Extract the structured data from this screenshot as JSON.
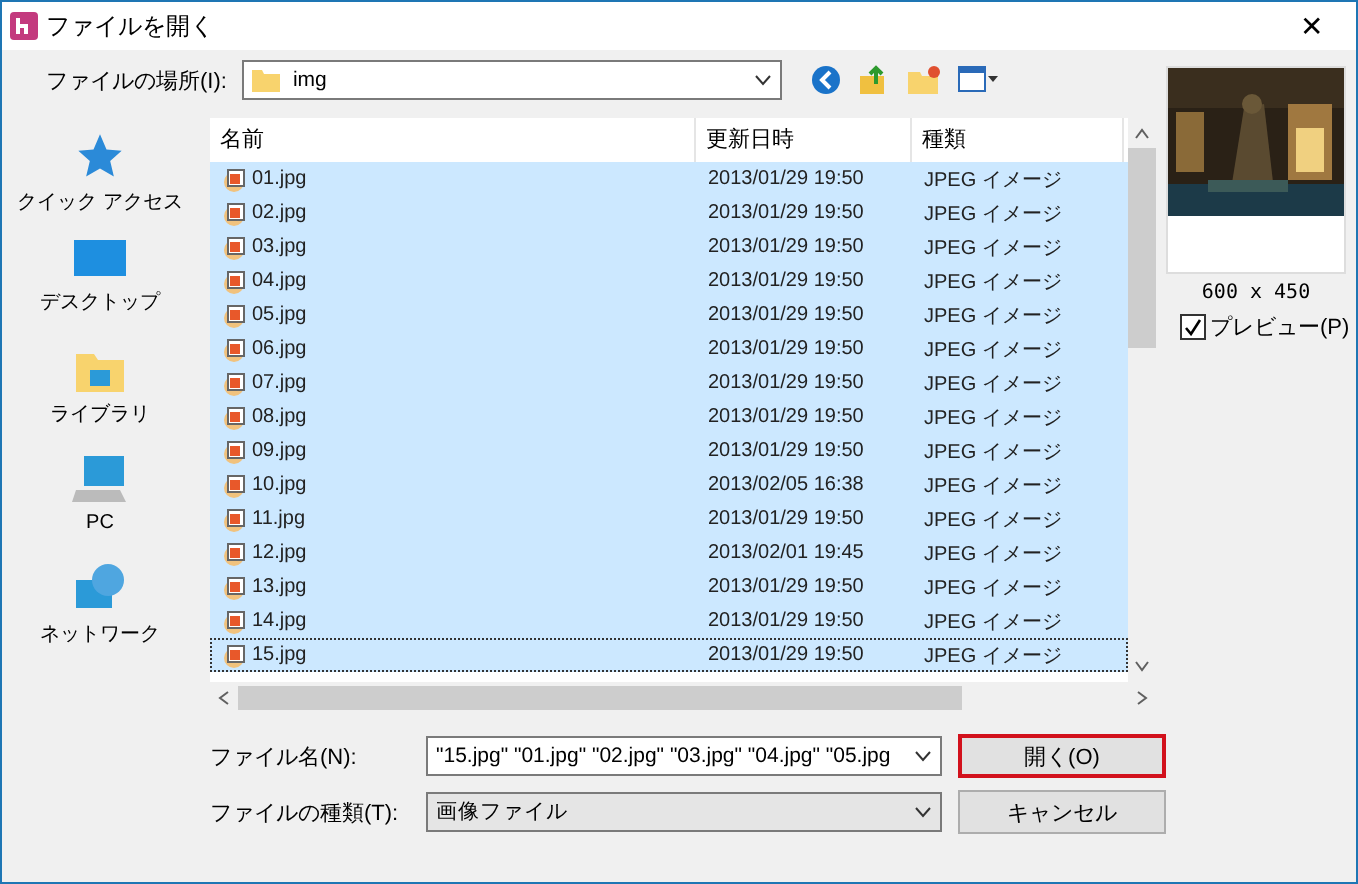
{
  "window": {
    "title": "ファイルを開く",
    "close": "✕"
  },
  "location": {
    "label": "ファイルの場所(I):",
    "value": "img"
  },
  "places": [
    {
      "label": "クイック アクセス",
      "kind": "star"
    },
    {
      "label": "デスクトップ",
      "kind": "desktop"
    },
    {
      "label": "ライブラリ",
      "kind": "library"
    },
    {
      "label": "PC",
      "kind": "pc"
    },
    {
      "label": "ネットワーク",
      "kind": "network"
    }
  ],
  "table": {
    "columns": [
      "名前",
      "更新日時",
      "種類"
    ],
    "rows": [
      {
        "name": "01.jpg",
        "date": "2013/01/29 19:50",
        "type": "JPEG イメージ",
        "selected": true,
        "focused": false
      },
      {
        "name": "02.jpg",
        "date": "2013/01/29 19:50",
        "type": "JPEG イメージ",
        "selected": true,
        "focused": false
      },
      {
        "name": "03.jpg",
        "date": "2013/01/29 19:50",
        "type": "JPEG イメージ",
        "selected": true,
        "focused": false
      },
      {
        "name": "04.jpg",
        "date": "2013/01/29 19:50",
        "type": "JPEG イメージ",
        "selected": true,
        "focused": false
      },
      {
        "name": "05.jpg",
        "date": "2013/01/29 19:50",
        "type": "JPEG イメージ",
        "selected": true,
        "focused": false
      },
      {
        "name": "06.jpg",
        "date": "2013/01/29 19:50",
        "type": "JPEG イメージ",
        "selected": true,
        "focused": false
      },
      {
        "name": "07.jpg",
        "date": "2013/01/29 19:50",
        "type": "JPEG イメージ",
        "selected": true,
        "focused": false
      },
      {
        "name": "08.jpg",
        "date": "2013/01/29 19:50",
        "type": "JPEG イメージ",
        "selected": true,
        "focused": false
      },
      {
        "name": "09.jpg",
        "date": "2013/01/29 19:50",
        "type": "JPEG イメージ",
        "selected": true,
        "focused": false
      },
      {
        "name": "10.jpg",
        "date": "2013/02/05 16:38",
        "type": "JPEG イメージ",
        "selected": true,
        "focused": false
      },
      {
        "name": "11.jpg",
        "date": "2013/01/29 19:50",
        "type": "JPEG イメージ",
        "selected": true,
        "focused": false
      },
      {
        "name": "12.jpg",
        "date": "2013/02/01 19:45",
        "type": "JPEG イメージ",
        "selected": true,
        "focused": false
      },
      {
        "name": "13.jpg",
        "date": "2013/01/29 19:50",
        "type": "JPEG イメージ",
        "selected": true,
        "focused": false
      },
      {
        "name": "14.jpg",
        "date": "2013/01/29 19:50",
        "type": "JPEG イメージ",
        "selected": true,
        "focused": false
      },
      {
        "name": "15.jpg",
        "date": "2013/01/29 19:50",
        "type": "JPEG イメージ",
        "selected": true,
        "focused": true
      }
    ]
  },
  "preview": {
    "kind": "picture",
    "size": "600 x 450",
    "checkbox": {
      "label": "プレビュー(P)",
      "checked": true
    }
  },
  "filename": {
    "label": "ファイル名(N):",
    "value": "\"15.jpg\" \"01.jpg\" \"02.jpg\" \"03.jpg\" \"04.jpg\" \"05.jpg"
  },
  "filetype": {
    "label": "ファイルの種類(T):",
    "value": "画像ファイル"
  },
  "buttons": [
    {
      "label": "開く(O)",
      "default": true
    },
    {
      "label": "キャンセル",
      "default": false
    }
  ]
}
